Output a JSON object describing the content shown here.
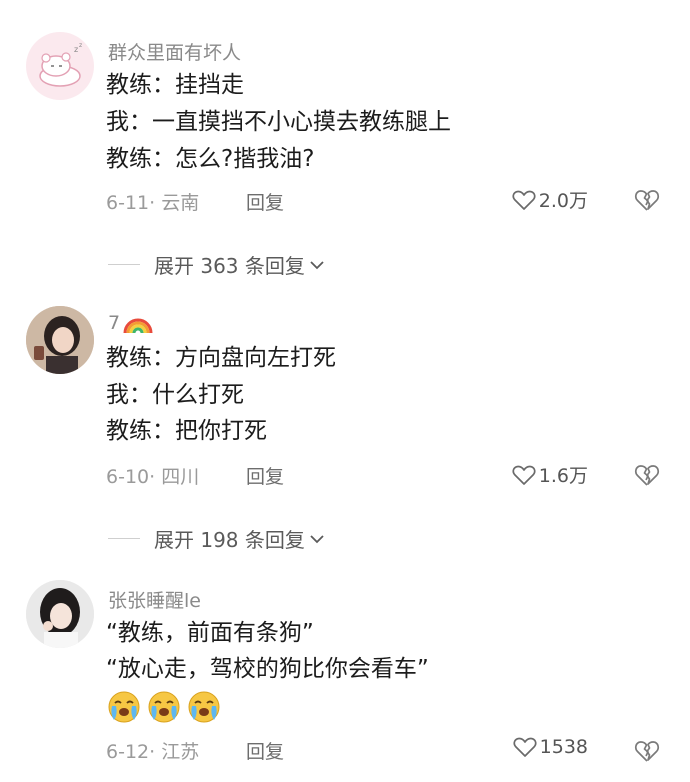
{
  "comments": [
    {
      "username": "群众里面有坏人",
      "lines": [
        "教练：挂挡走",
        "我：一直摸挡不小心摸去教练腿上",
        "教练：怎么?揩我油?"
      ],
      "date_location": "6-11· 云南",
      "reply_label": "回复",
      "likes": "2.0万",
      "expand_label": "展开 363 条回复"
    },
    {
      "username": "7",
      "username_icon": "rainbow-icon",
      "lines": [
        "教练：方向盘向左打死",
        "我：什么打死",
        "教练：把你打死"
      ],
      "date_location": "6-10· 四川",
      "reply_label": "回复",
      "likes": "1.6万",
      "expand_label": "展开 198 条回复"
    },
    {
      "username": "张张睡醒le",
      "lines": [
        "“教练，前面有条狗”",
        "“放心走，驾校的狗比你会看车”"
      ],
      "emojis": [
        "crying-emoji",
        "crying-emoji",
        "crying-emoji"
      ],
      "date_location": "6-12· 江苏",
      "reply_label": "回复",
      "likes": "1538"
    }
  ],
  "colors": {
    "text": "#1c1c1c",
    "meta": "#9a9a9a",
    "username": "#8a8a8a",
    "heart": "#6a6a6a"
  }
}
